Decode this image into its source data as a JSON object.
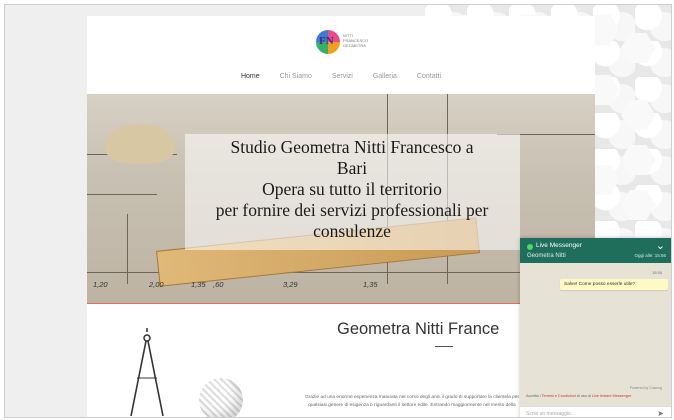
{
  "brand": {
    "logo_letters": "FN",
    "logo_text": [
      "NITTI",
      "FRANCESCO",
      "GEOMETRA"
    ]
  },
  "nav": {
    "items": [
      {
        "label": "Home",
        "active": true
      },
      {
        "label": "Chi Siamo",
        "active": false
      },
      {
        "label": "Servizi",
        "active": false
      },
      {
        "label": "Galleria",
        "active": false
      },
      {
        "label": "Contatti",
        "active": false
      }
    ]
  },
  "hero": {
    "lines": [
      "Studio Geometra Nitti Francesco a",
      "Bari",
      "Opera su tutto il territorio",
      "per fornire dei servizi professionali per",
      "consulenze"
    ],
    "dimensions": [
      "1,20",
      "2,00",
      "1,35",
      ",60",
      "3,29",
      "1,35"
    ]
  },
  "about": {
    "title": "Geometra Nitti France",
    "body": "Grazie ad una enorme esperienza maturata nel corso degli anni il grado di supportare la clientela per qualsiasi genere di esigenza b riguardanti il settore edile. Entrando maggiormente nel merito della"
  },
  "chat": {
    "title": "Live Messenger",
    "contact": "Geometra Nitti",
    "last_seen": "Oggi alle: 15:56",
    "time": "15:56",
    "message": "Salve! Come posso esserle utile?",
    "footnote": "Powered by Cusmsg",
    "consent_prefix": "Accetta i ",
    "consent_link1": "Termini e Condizioni",
    "consent_mid": " di uso di ",
    "consent_link2": "Live Instant Messenger",
    "input_placeholder": "Scrivi un messaggio...",
    "colors": {
      "header": "#1f6e5c",
      "bubble": "#fff9c4",
      "online": "#4cd964"
    }
  }
}
